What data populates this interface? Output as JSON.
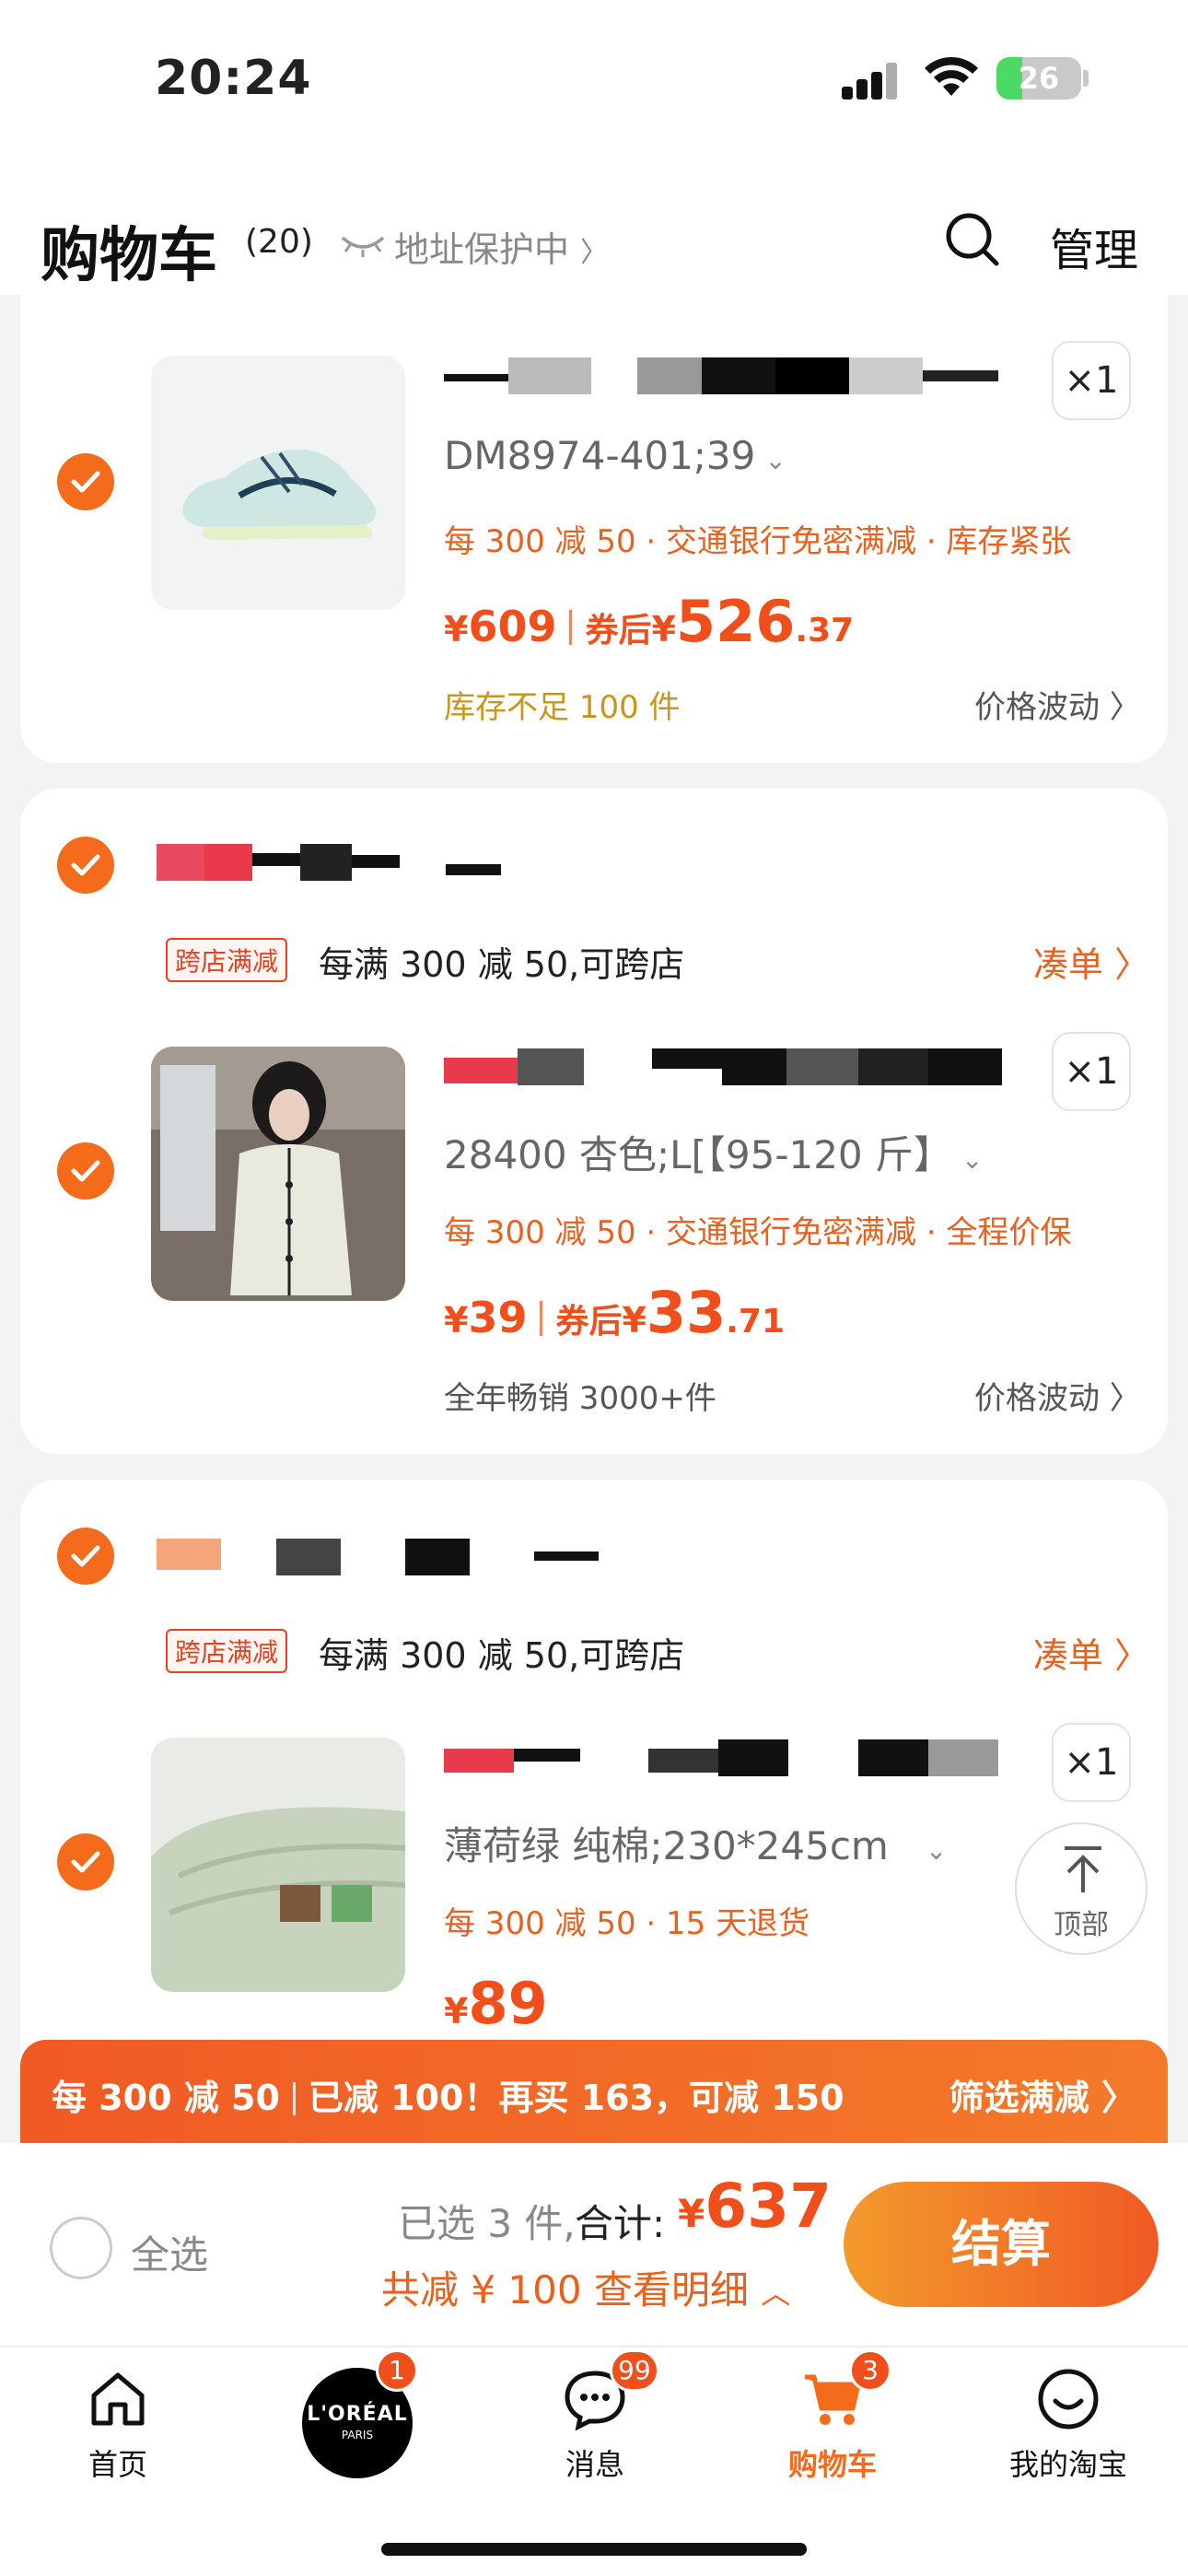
{
  "status": {
    "time": "20:24",
    "battery": "26"
  },
  "header": {
    "title": "购物车",
    "count": "(20)",
    "address": "地址保护中",
    "manage": "管理"
  },
  "items": [
    {
      "qty": "×1",
      "sku": "DM8974-401;39",
      "promo": "每 300 减 50 · 交通银行免密满减 · 库存紧张",
      "price_yen": "¥",
      "price": "609",
      "coupon_label": "券后",
      "coupon_yen": "¥",
      "coupon_int": "526",
      "coupon_dec": ".37",
      "note": "库存不足 100 件",
      "fluctuation": "价格波动"
    },
    {
      "store_tag": "跨店满减",
      "store_text": "每满 300 减 50,可跨店",
      "coudan": "凑单",
      "qty": "×1",
      "sku": "28400 杏色;L[【95-120 斤】",
      "promo": "每 300 减 50 · 交通银行免密满减 · 全程价保",
      "price_yen": "¥",
      "price": "39",
      "coupon_label": "券后",
      "coupon_yen": "¥",
      "coupon_int": "33",
      "coupon_dec": ".71",
      "note": "全年畅销 3000+件",
      "fluctuation": "价格波动"
    },
    {
      "store_tag": "跨店满减",
      "store_text": "每满 300 减 50,可跨店",
      "coudan": "凑单",
      "qty": "×1",
      "sku": "薄荷绿 纯棉;230*245cm",
      "promo": "每 300 减 50 · 15 天退货",
      "price_yen": "¥",
      "price": "89"
    }
  ],
  "back_to_top": "顶部",
  "promo_bar": {
    "rule": "每 300 减 50",
    "status": "已减 100！再买 163，可减 150",
    "filter": "筛选满减"
  },
  "checkout": {
    "select_all": "全选",
    "selected": "已选 3 件,",
    "total_label": "合计:",
    "total_yen": "¥",
    "total": "637",
    "saved": "共减 ¥ 100  查看明细",
    "pay": "结算"
  },
  "tabs": [
    {
      "label": "首页",
      "icon": "home-icon"
    },
    {
      "label": "",
      "icon": "loreal-logo",
      "badge": "1",
      "brand": "L'ORÉAL",
      "brand_sub": "PARIS"
    },
    {
      "label": "消息",
      "icon": "message-icon",
      "badge": "99"
    },
    {
      "label": "购物车",
      "icon": "cart-icon",
      "badge": "3"
    },
    {
      "label": "我的淘宝",
      "icon": "profile-icon"
    }
  ],
  "colors": {
    "accent": "#f36b1b",
    "price": "#f04f1b",
    "note_gold": "#c8961e"
  }
}
